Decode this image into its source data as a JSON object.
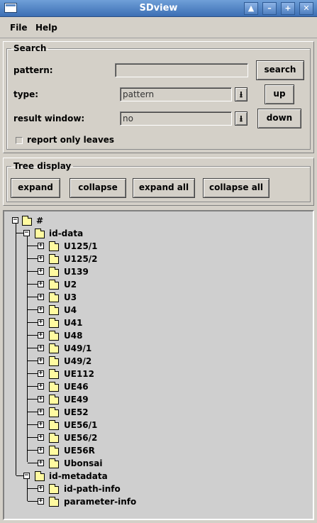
{
  "window": {
    "title": "SDview"
  },
  "menu": {
    "file": "File",
    "help": "Help"
  },
  "search": {
    "legend": "Search",
    "pattern_label": "pattern:",
    "pattern_value": "",
    "search_button": "search",
    "type_label": "type:",
    "type_value": "pattern",
    "up_button": "up",
    "result_label": "result window:",
    "result_value": "no",
    "down_button": "down",
    "leaves_label": "report only leaves"
  },
  "tree_display": {
    "legend": "Tree display",
    "expand": "expand",
    "collapse": "collapse",
    "expand_all": "expand all",
    "collapse_all": "collapse all"
  },
  "tree": {
    "root": "#",
    "id_data": "id-data",
    "id_data_children": [
      "U125/1",
      "U125/2",
      "U139",
      "U2",
      "U3",
      "U4",
      "U41",
      "U48",
      "U49/1",
      "U49/2",
      "UE112",
      "UE46",
      "UE49",
      "UE52",
      "UE56/1",
      "UE56/2",
      "UE56R",
      "Ubonsai"
    ],
    "id_metadata": "id-metadata",
    "id_metadata_children": [
      "id-path-info",
      "parameter-info"
    ]
  }
}
